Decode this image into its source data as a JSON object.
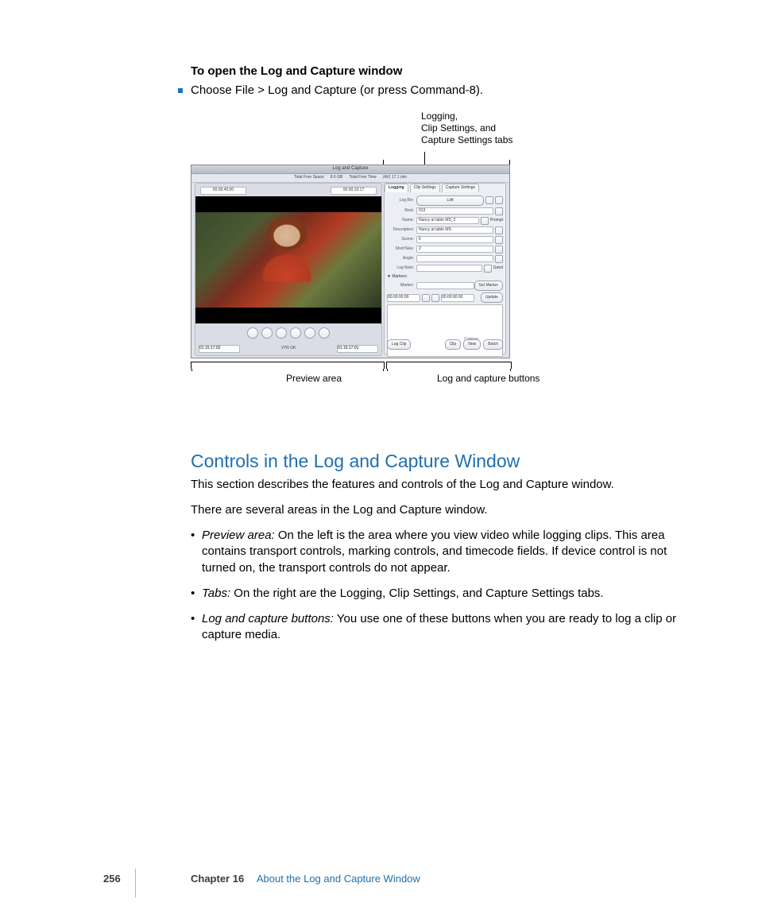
{
  "task": {
    "title": "To open the Log and Capture window",
    "step": "Choose File > Log and Capture (or press Command-8)."
  },
  "figure": {
    "callouts": {
      "tabs_line1": "Logging,",
      "tabs_line2": "Clip Settings, and",
      "tabs_line3": "Capture Settings tabs",
      "preview": "Preview area",
      "buttons": "Log and capture buttons"
    },
    "window": {
      "title": "Log and Capture",
      "header_free_space_label": "Total Free Space",
      "header_free_space_value": "8.6 GB",
      "header_free_time_label": "Total Free Time",
      "header_free_time_value": "(AV) 17.1 min",
      "tc_top_left": "00:00:40:00",
      "tc_top_right": "00:00:10:17",
      "tc_bottom_left": "01:15:17:02",
      "tc_bottom_right": "01:15:17:01",
      "mode": "VTR OK"
    },
    "tabs": {
      "logging": "Logging",
      "clip_settings": "Clip Settings",
      "capture_settings": "Capture Settings"
    },
    "logging": {
      "log_bin_label": "Log Bin:",
      "log_bin_value": "Loft",
      "reel_label": "Reel:",
      "reel_value": "013",
      "name_label": "Name:",
      "name_value": "Nancy at table MS_2",
      "prompt_label": "Prompt",
      "description_label": "Description:",
      "description_value": "Nancy at table MS",
      "scene_label": "Scene:",
      "scene_value": "6",
      "shot_take_label": "Shot/Take:",
      "shot_take_value": "2",
      "angle_label": "Angle:",
      "angle_value": "",
      "log_note_label": "Log Note:",
      "log_note_value": "",
      "good_label": "Good",
      "markers_label": "▼ Markers:",
      "marker_label": "Marker:",
      "set_marker_btn": "Set Marker",
      "update_btn": "Update",
      "tc1": "00:00:00:00",
      "tc2": "00:00:00:00"
    },
    "buttons": {
      "capture_label": "Capture",
      "log_clip": "Log Clip",
      "clip": "Clip",
      "now": "Now",
      "batch": "Batch"
    }
  },
  "section": {
    "title": "Controls in the Log and Capture Window",
    "intro1": "This section describes the features and controls of the Log and Capture window.",
    "intro2": "There are several areas in the Log and Capture window.",
    "bullets": [
      {
        "term": "Preview area:",
        "text": "  On the left is the area where you view video while logging clips. This area contains transport controls, marking controls, and timecode fields. If device control is not turned on, the transport controls do not appear."
      },
      {
        "term": "Tabs:",
        "text": "  On the right are the Logging, Clip Settings, and Capture Settings tabs."
      },
      {
        "term": "Log and capture buttons:",
        "text": "  You use one of these buttons when you are ready to log a clip or capture media."
      }
    ]
  },
  "footer": {
    "page": "256",
    "chapter_label": "Chapter 16",
    "chapter_title": "About the Log and Capture Window"
  }
}
